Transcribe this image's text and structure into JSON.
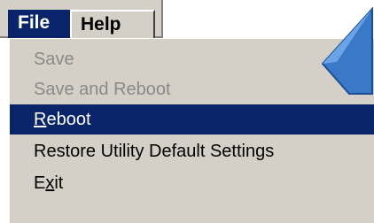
{
  "menubar": {
    "file": "File",
    "help": "Help"
  },
  "menu": {
    "items": [
      {
        "label": "Save",
        "state": "disabled"
      },
      {
        "label": "Save and Reboot",
        "state": "disabled"
      },
      {
        "label_mnemonic": "R",
        "label_rest": "eboot",
        "state": "selected"
      },
      {
        "label": "Restore Utility Default Settings",
        "state": "enabled"
      },
      {
        "label_prefix": "E",
        "label_mnemonic": "x",
        "label_rest": "it",
        "state": "enabled"
      }
    ]
  },
  "colors": {
    "menu_bg": "#d4d0c8",
    "highlight": "#0a246a",
    "disabled_text": "#8a8a8a",
    "cursor_arrow": "#3a78c8"
  },
  "icons": {
    "cursor": "cursor-arrow-icon"
  }
}
